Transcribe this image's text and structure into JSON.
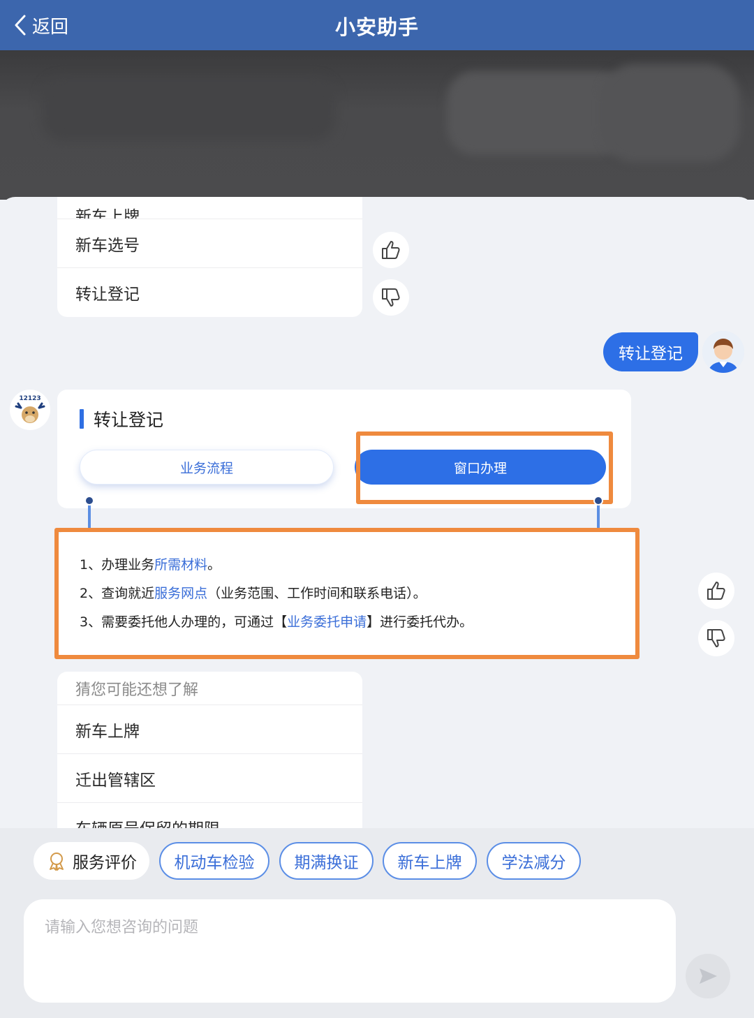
{
  "header": {
    "back_label": "返回",
    "title": "小安助手"
  },
  "prev_list": {
    "partial_item": "新车上牌",
    "items": [
      "新车选号",
      "转让登记"
    ]
  },
  "user_message": "转让登记",
  "bot": {
    "avatar_badge": "12123",
    "card_title": "转让登记",
    "tab_process": "业务流程",
    "tab_window": "窗口办理"
  },
  "info": {
    "line1": {
      "prefix": "1、办理业务",
      "link": "所需材料",
      "suffix": "。"
    },
    "line2": {
      "prefix": "2、查询就近",
      "link": "服务网点",
      "suffix": "（业务范围、工作时间和联系电话）。"
    },
    "line3": {
      "prefix": "3、需要委托他人办理的，可通过【",
      "link": "业务委托申请",
      "suffix": "】进行委托代办。"
    }
  },
  "suggest": {
    "header": "猜您可能还想了解",
    "items": [
      "新车上牌",
      "迁出管辖区",
      "车辆原号保留的期限"
    ]
  },
  "bottom": {
    "rate_label": "服务评价",
    "quick_chips": [
      "机动车检验",
      "期满换证",
      "新车上牌",
      "学法减分"
    ],
    "input_placeholder": "请输入您想咨询的问题"
  },
  "colors": {
    "header": "#3c66ad",
    "accent": "#2d6fe6",
    "highlight": "#ef8a3e"
  }
}
